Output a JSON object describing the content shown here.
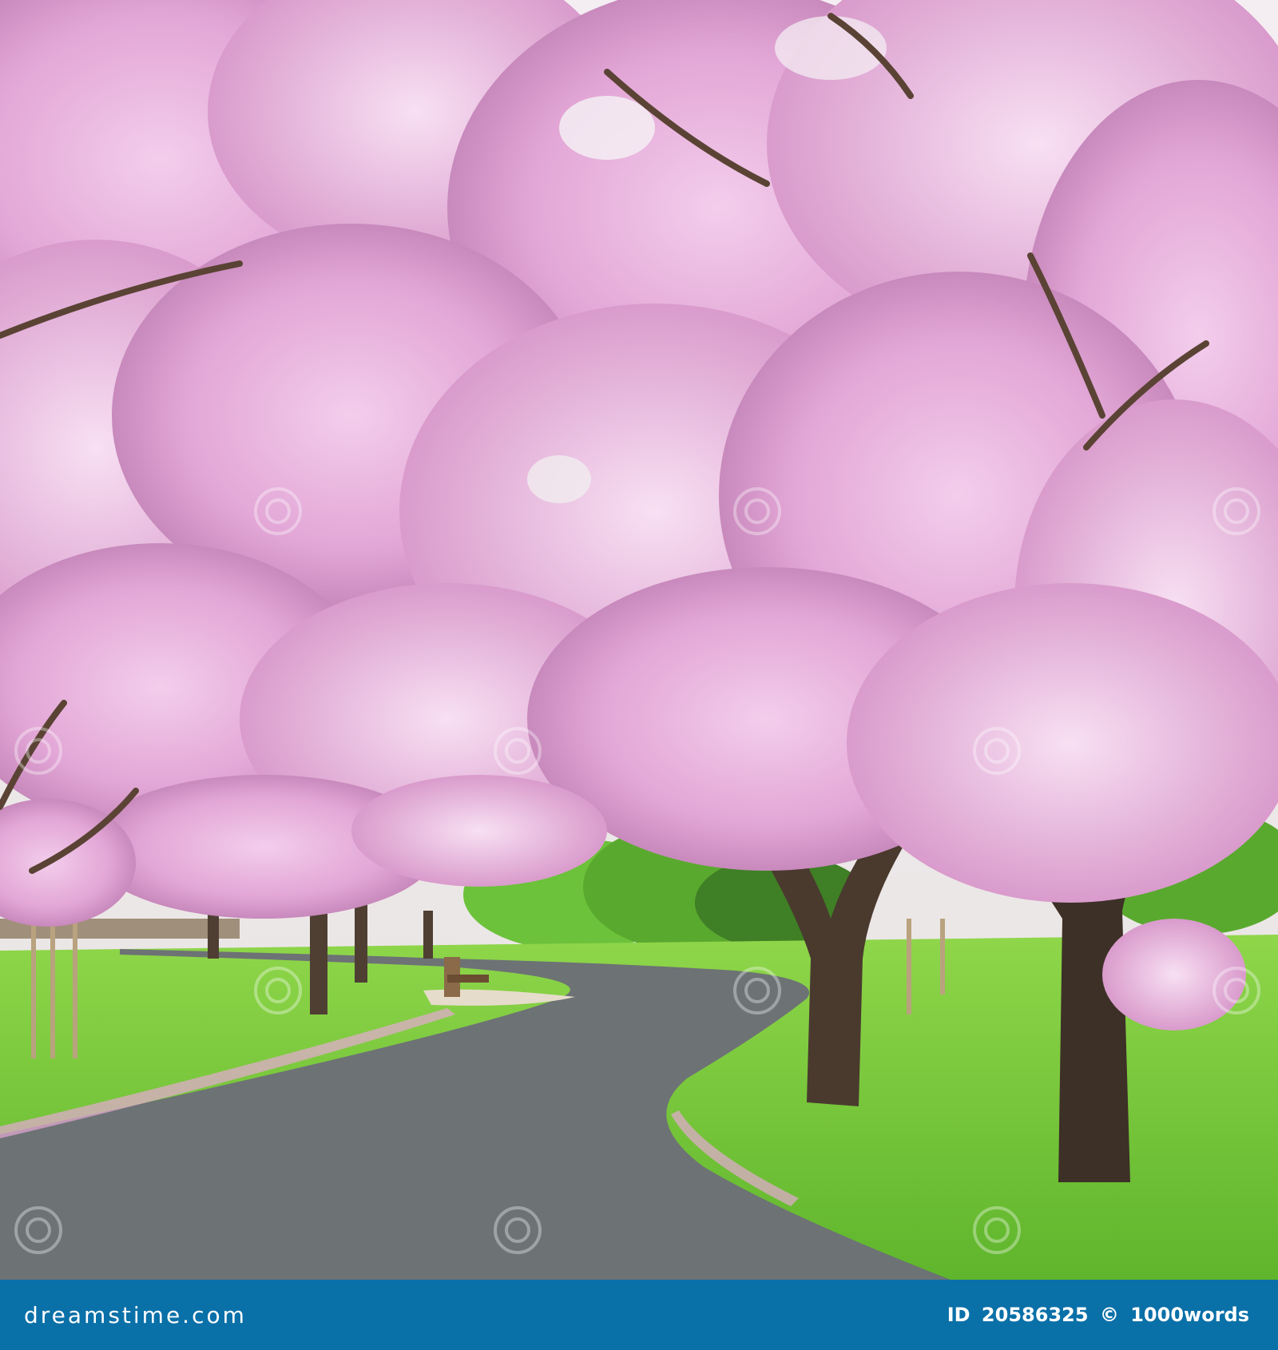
{
  "footer": {
    "logo": "dreamstime.com",
    "id_label": "ID",
    "id_value": "20586325",
    "copyright": "©",
    "author": "1000words"
  },
  "colors": {
    "footer_bg": "#0a70a8",
    "blossom": "#e9b3df",
    "blossom_dark": "#c27bb5",
    "grass": "#7ccf3f",
    "path": "#6d7275",
    "trunk": "#4a3a2e"
  },
  "scene": {
    "subject": "pink cherry blossom trees over curved park path",
    "icons": [
      "dreamstime-watermark-icon"
    ]
  }
}
